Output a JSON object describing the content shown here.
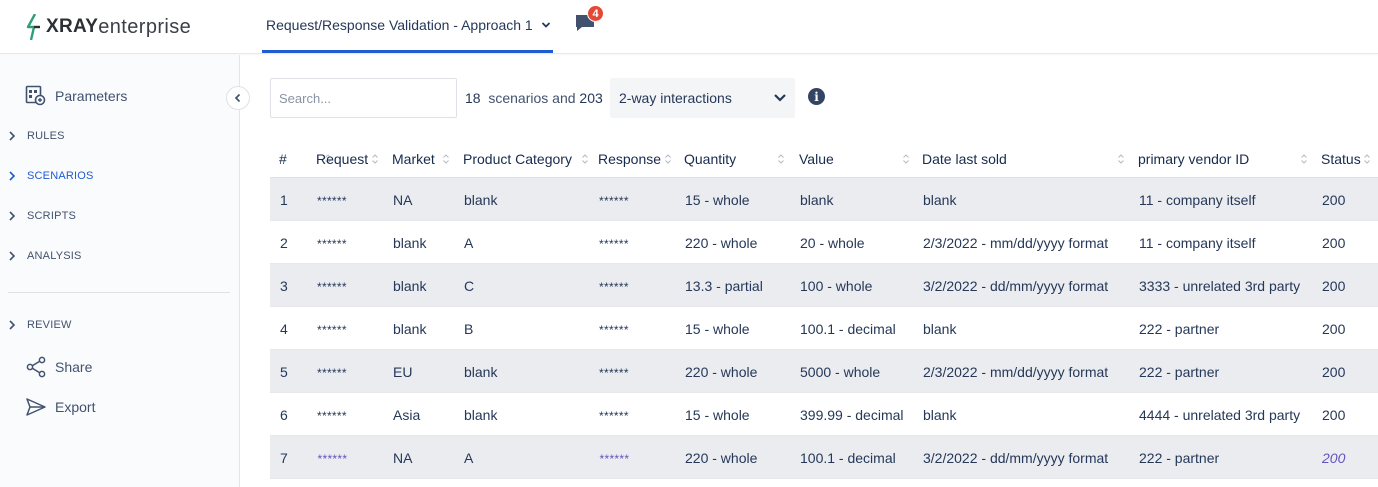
{
  "app": {
    "logo_bold": "XRAY",
    "logo_light": "enterprise",
    "tab_title": "Request/Response Validation - Approach 1",
    "notifications_count": "4"
  },
  "sidebar": {
    "parameters_label": "Parameters",
    "sections": [
      {
        "label": "RULES"
      },
      {
        "label": "SCENARIOS"
      },
      {
        "label": "SCRIPTS"
      },
      {
        "label": "ANALYSIS"
      },
      {
        "label": "REVIEW"
      }
    ],
    "share_label": "Share",
    "export_label": "Export"
  },
  "toolbar": {
    "search_placeholder": "Search...",
    "scenario_count": "18",
    "scenarios_and": "scenarios and",
    "interaction_count": "203",
    "interaction_select": "2-way interactions",
    "info_glyph": "i"
  },
  "table": {
    "headers": [
      "#",
      "Request",
      "Market",
      "Product Category",
      "Response",
      "Quantity",
      "Value",
      "Date last sold",
      "primary vendor ID",
      "Status"
    ],
    "rows": [
      [
        "1",
        "******",
        "NA",
        "blank",
        "******",
        "15 - whole",
        "blank",
        "blank",
        "11 - company itself",
        "200"
      ],
      [
        "2",
        "******",
        "blank",
        "A",
        "******",
        "220 - whole",
        "20 - whole",
        "2/3/2022 - mm/dd/yyyy format",
        "11 - company itself",
        "200"
      ],
      [
        "3",
        "******",
        "blank",
        "C",
        "******",
        "13.3 - partial",
        "100 - whole",
        "3/2/2022 - dd/mm/yyyy format",
        "3333 - unrelated 3rd party",
        "200"
      ],
      [
        "4",
        "******",
        "blank",
        "B",
        "******",
        "15 - whole",
        "100.1 - decimal",
        "blank",
        "222 - partner",
        "200"
      ],
      [
        "5",
        "******",
        "EU",
        "blank",
        "******",
        "220 - whole",
        "5000 - whole",
        "2/3/2022 - mm/dd/yyyy format",
        "222 - partner",
        "200"
      ],
      [
        "6",
        "******",
        "Asia",
        "blank",
        "******",
        "15 - whole",
        "399.99 - decimal",
        "blank",
        "4444 - unrelated 3rd party",
        "200"
      ],
      [
        "7",
        "******",
        "NA",
        "A",
        "******",
        "220 - whole",
        "100.1 - decimal",
        "3/2/2022 - dd/mm/yyyy format",
        "222 - partner",
        "200"
      ]
    ]
  }
}
